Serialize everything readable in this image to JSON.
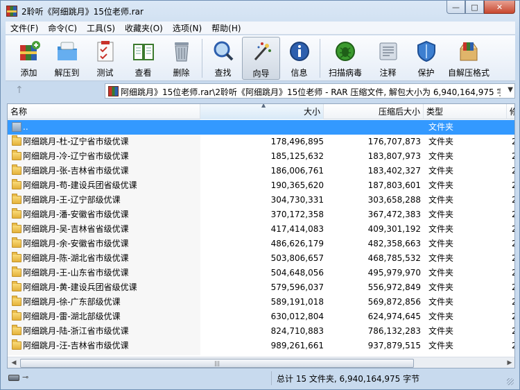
{
  "window": {
    "title": "2聆听《阿细跳月》15位老师.rar",
    "buttons": [
      "—",
      "□",
      "✕"
    ]
  },
  "menu": [
    "文件(F)",
    "命令(C)",
    "工具(S)",
    "收藏夹(O)",
    "选项(N)",
    "帮助(H)"
  ],
  "toolbar": [
    {
      "label": "添加",
      "icon": "add-icon"
    },
    {
      "label": "解压到",
      "icon": "extract-to-icon"
    },
    {
      "label": "测试",
      "icon": "test-icon"
    },
    {
      "label": "查看",
      "icon": "view-icon"
    },
    {
      "label": "删除",
      "icon": "delete-icon"
    },
    {
      "label": "查找",
      "icon": "find-icon"
    },
    {
      "label": "向导",
      "icon": "wizard-icon"
    },
    {
      "label": "信息",
      "icon": "info-icon"
    },
    {
      "label": "扫描病毒",
      "icon": "virus-scan-icon"
    },
    {
      "label": "注释",
      "icon": "comment-icon"
    },
    {
      "label": "保护",
      "icon": "protect-icon"
    },
    {
      "label": "自解压格式",
      "icon": "sfx-icon"
    }
  ],
  "address": "阿细跳月》15位老师.rar\\2聆听《阿细跳月》15位老师 - RAR 压缩文件, 解包大小为 6,940,164,975 字节",
  "columns": {
    "name": "名称",
    "size": "大小",
    "packed": "压缩后大小",
    "type": "类型",
    "more": "修"
  },
  "up_row": {
    "name": "..",
    "type": "文件夹"
  },
  "files": [
    {
      "name": "阿细跳月-杜-辽宁省市级优课",
      "size": "178,496,895",
      "packed": "176,707,873",
      "type": "文件夹",
      "more": "2"
    },
    {
      "name": "阿细跳月-冷-辽宁省市级优课",
      "size": "185,125,632",
      "packed": "183,807,973",
      "type": "文件夹",
      "more": "2"
    },
    {
      "name": "阿细跳月-张-吉林省市级优课",
      "size": "186,006,761",
      "packed": "183,402,327",
      "type": "文件夹",
      "more": "2"
    },
    {
      "name": "阿细跳月-苟-建设兵团省级优课",
      "size": "190,365,620",
      "packed": "187,803,601",
      "type": "文件夹",
      "more": "2"
    },
    {
      "name": "阿细跳月-王-辽宁部级优课",
      "size": "304,730,331",
      "packed": "303,658,288",
      "type": "文件夹",
      "more": "2"
    },
    {
      "name": "阿细跳月-潘-安徽省市级优课",
      "size": "370,172,358",
      "packed": "367,472,383",
      "type": "文件夹",
      "more": "2"
    },
    {
      "name": "阿细跳月-吴-吉林省省级优课",
      "size": "417,414,083",
      "packed": "409,301,192",
      "type": "文件夹",
      "more": "2"
    },
    {
      "name": "阿细跳月-余-安徽省市级优课",
      "size": "486,626,179",
      "packed": "482,358,663",
      "type": "文件夹",
      "more": "2"
    },
    {
      "name": "阿细跳月-陈-湖北省市级优课",
      "size": "503,806,657",
      "packed": "468,785,532",
      "type": "文件夹",
      "more": "2"
    },
    {
      "name": "阿细跳月-王-山东省市级优课",
      "size": "504,648,056",
      "packed": "495,979,970",
      "type": "文件夹",
      "more": "2"
    },
    {
      "name": "阿细跳月-黄-建设兵团省级优课",
      "size": "579,596,037",
      "packed": "556,972,849",
      "type": "文件夹",
      "more": "2"
    },
    {
      "name": "阿细跳月-徐-广东部级优课",
      "size": "589,191,018",
      "packed": "569,872,856",
      "type": "文件夹",
      "more": "2"
    },
    {
      "name": "阿细跳月-雷-湖北部级优课",
      "size": "630,012,804",
      "packed": "624,974,645",
      "type": "文件夹",
      "more": "2"
    },
    {
      "name": "阿细跳月-陆-浙江省市级优课",
      "size": "824,710,883",
      "packed": "786,132,283",
      "type": "文件夹",
      "more": "2"
    },
    {
      "name": "阿细跳月-汪-吉林省市级优课",
      "size": "989,261,661",
      "packed": "937,879,515",
      "type": "文件夹",
      "more": "2"
    }
  ],
  "status": "总计 15 文件夹, 6,940,164,975 字节"
}
